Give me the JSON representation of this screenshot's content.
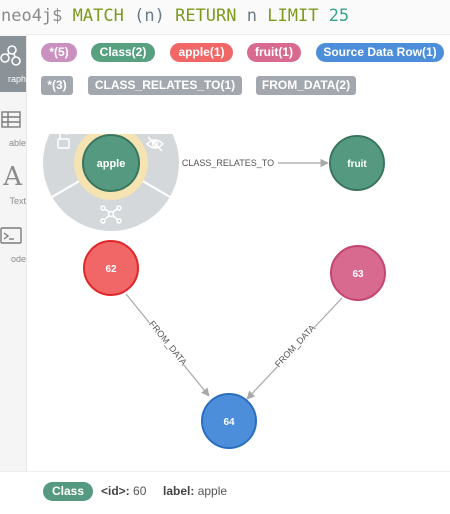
{
  "query": {
    "prompt": "neo4j$",
    "kw_match": "MATCH",
    "pattern": "(n)",
    "kw_return": "RETURN",
    "var": "n",
    "kw_limit": "LIMIT",
    "limit": "25"
  },
  "sidebar": {
    "items": [
      {
        "label": "raph",
        "icon": "graph-icon",
        "active": true
      },
      {
        "label": "able",
        "icon": "table-icon",
        "active": false
      },
      {
        "label": "Text",
        "icon": "text-icon",
        "glyph": "A",
        "active": false
      },
      {
        "label": "ode",
        "icon": "code-icon",
        "active": false
      }
    ]
  },
  "labels": [
    {
      "text": "*(5)",
      "color": "#c990c0"
    },
    {
      "text": "Class(2)",
      "color": "#57a080"
    },
    {
      "text": "apple(1)",
      "color": "#f16667"
    },
    {
      "text": "fruit(1)",
      "color": "#d86a8f"
    },
    {
      "text": "Source Data Row(1)",
      "color": "#4c8eda"
    }
  ],
  "relationship_types": [
    {
      "text": "*(3)"
    },
    {
      "text": "CLASS_RELATES_TO(1)"
    },
    {
      "text": "FROM_DATA(2)"
    }
  ],
  "graph": {
    "nodes": [
      {
        "id": "apple",
        "caption": "apple",
        "color": "#559a80",
        "stroke": "#3a7560",
        "selected": true
      },
      {
        "id": "fruit",
        "caption": "fruit",
        "color": "#559a80",
        "stroke": "#3a7560"
      },
      {
        "id": "n62",
        "caption": "62",
        "color": "#f16667",
        "stroke": "#e0262a"
      },
      {
        "id": "n63",
        "caption": "63",
        "color": "#d86a8f",
        "stroke": "#c4466e"
      },
      {
        "id": "n64",
        "caption": "64",
        "color": "#4c8eda",
        "stroke": "#2a6ec0"
      }
    ],
    "relationships": [
      {
        "from": "apple",
        "to": "fruit",
        "type": "CLASS_RELATES_TO"
      },
      {
        "from": "n62",
        "to": "n64",
        "type": "FROM_DATA"
      },
      {
        "from": "n63",
        "to": "n64",
        "type": "FROM_DATA"
      }
    ],
    "ring_icons": [
      "unlock-icon",
      "hide-eye-icon",
      "expand-icon"
    ]
  },
  "details": {
    "label": "Class",
    "id_key": "<id>:",
    "id_value": "60",
    "label_key": "label:",
    "label_value": "apple"
  }
}
